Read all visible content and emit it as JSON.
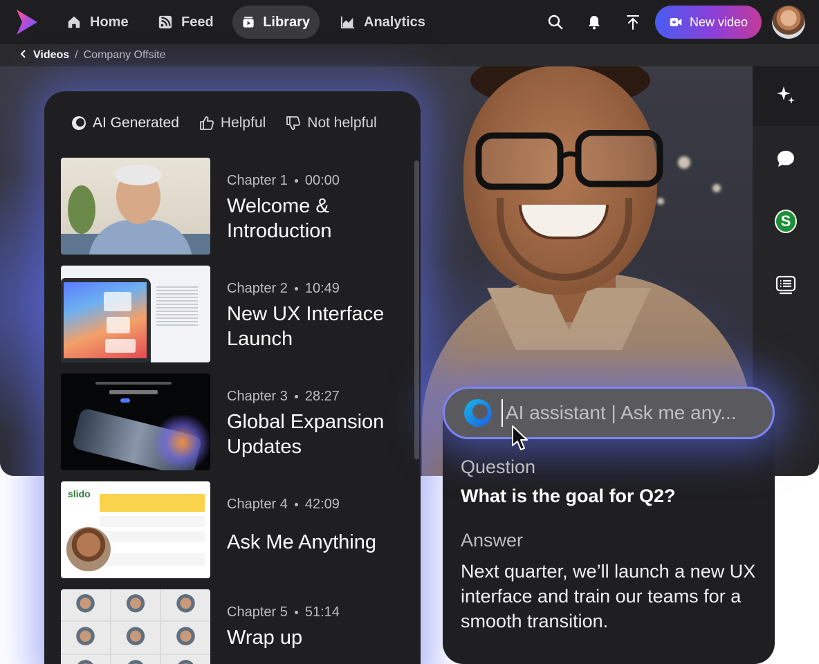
{
  "nav": {
    "items": [
      {
        "label": "Home",
        "icon": "home-icon"
      },
      {
        "label": "Feed",
        "icon": "feed-icon"
      },
      {
        "label": "Library",
        "icon": "library-icon",
        "active": true
      },
      {
        "label": "Analytics",
        "icon": "analytics-icon"
      }
    ],
    "new_video_label": "New video"
  },
  "breadcrumb": {
    "parent": "Videos",
    "current": "Company Offsite"
  },
  "chapters_panel": {
    "ai_generated_label": "AI Generated",
    "helpful_label": "Helpful",
    "not_helpful_label": "Not helpful",
    "chapters": [
      {
        "number": "Chapter 1",
        "time": "00:00",
        "title": "Welcome & Introduction"
      },
      {
        "number": "Chapter 2",
        "time": "10:49",
        "title": "New UX Interface Launch"
      },
      {
        "number": "Chapter 3",
        "time": "28:27",
        "title": "Global Expansion Updates"
      },
      {
        "number": "Chapter 4",
        "time": "42:09",
        "title": "Ask Me Anything"
      },
      {
        "number": "Chapter 5",
        "time": "51:14",
        "title": "Wrap up"
      }
    ],
    "thumb4_brand": "slido"
  },
  "assistant": {
    "placeholder": "AI assistant | Ask me any...",
    "question_label": "Question",
    "question": "What is the goal for Q2?",
    "answer_label": "Answer",
    "answer": "Next quarter, we’ll launch a new UX interface and train our teams for a smooth transition."
  },
  "rail": {
    "badge_letter": "S"
  },
  "colors": {
    "accent": "#5f6ef0",
    "new_video_gradient_start": "#4b5cf0",
    "new_video_gradient_end": "#c23b9a",
    "badge_green": "#1e8f3a"
  }
}
